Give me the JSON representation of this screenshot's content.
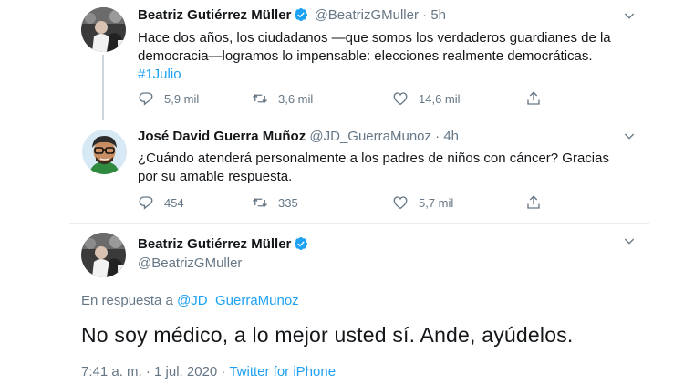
{
  "tweets": [
    {
      "name": "Beatriz Gutiérrez Müller",
      "handle": "@BeatrizGMuller",
      "time": "· 5h",
      "text_line1": "Hace dos años, los ciudadanos —que somos los verdaderos guardianes de la",
      "text_line2": "democracia—logramos lo impensable: elecciones realmente democráticas.",
      "hashtag": "#1Julio",
      "replies": "5,9 mil",
      "retweets": "3,6 mil",
      "likes": "14,6 mil"
    },
    {
      "name": "José David Guerra Muñoz",
      "handle": "@JD_GuerraMunoz",
      "time": "· 4h",
      "text_line1": "¿Cuándo atenderá personalmente a los padres de niños con cáncer? Gracias",
      "text_line2": "por su amable respuesta.",
      "replies": "454",
      "retweets": "335",
      "likes": "5,7 mil"
    },
    {
      "name": "Beatriz Gutiérrez Müller",
      "handle": "@BeatrizGMuller",
      "reply_prefix": "En respuesta a",
      "reply_mention": "@JD_GuerraMunoz",
      "text": "No soy médico, a lo mejor usted sí. Ande, ayúdelos.",
      "timestamp": "7:41 a. m. · 1 jul. 2020 ·",
      "source": "Twitter for iPhone"
    }
  ],
  "icons": {
    "verified": "verified-badge-icon",
    "caret": "chevron-down-icon",
    "reply": "reply-icon",
    "retweet": "retweet-icon",
    "like": "heart-icon",
    "share": "share-icon"
  },
  "colors": {
    "accent": "#1da1f2",
    "secondary_text": "#657786",
    "primary_text": "#14171a",
    "divider": "#e6ecf0"
  }
}
